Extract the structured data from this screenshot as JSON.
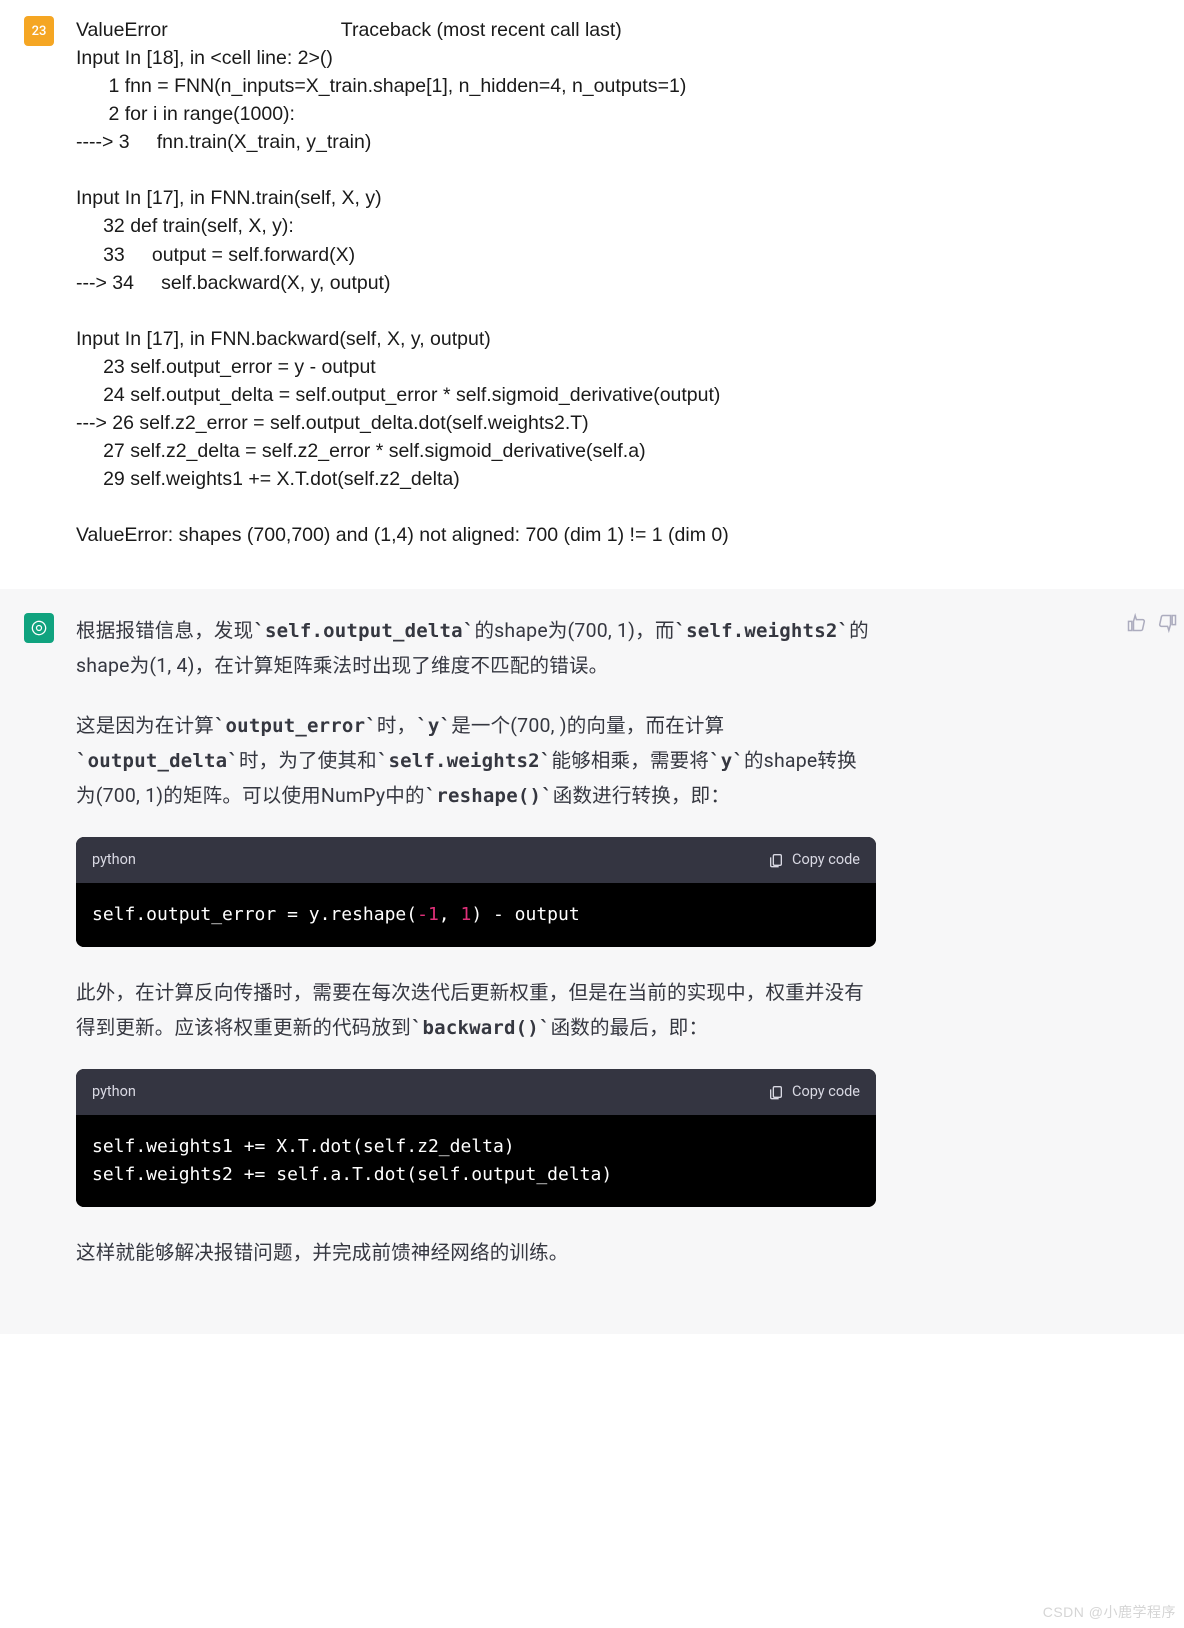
{
  "user": {
    "badge": "23",
    "traceback": {
      "l1": "ValueError                                Traceback (most recent call last)",
      "l2": "Input In [18], in <cell line: 2>()",
      "l3": "      1 fnn = FNN(n_inputs=X_train.shape[1], n_hidden=4, n_outputs=1)",
      "l4": "      2 for i in range(1000):",
      "l5": "----> 3     fnn.train(X_train, y_train)",
      "l6": "Input In [17], in FNN.train(self, X, y)",
      "l7": "     32 def train(self, X, y):",
      "l8": "     33     output = self.forward(X)",
      "l9": "---> 34     self.backward(X, y, output)",
      "l10": "Input In [17], in FNN.backward(self, X, y, output)",
      "l11": "     23 self.output_error = y - output",
      "l12": "     24 self.output_delta = self.output_error * self.sigmoid_derivative(output)",
      "l13": "---> 26 self.z2_error = self.output_delta.dot(self.weights2.T)",
      "l14": "     27 self.z2_delta = self.z2_error * self.sigmoid_derivative(self.a)",
      "l15": "     29 self.weights1 += X.T.dot(self.z2_delta)",
      "l16": "ValueError: shapes (700,700) and (1,4) not aligned: 700 (dim 1) != 1 (dim 0)"
    }
  },
  "assistant": {
    "p1": {
      "t1": "根据报错信息，发现",
      "c1": "`self.output_delta`",
      "t2": "的shape为(700, 1)，而",
      "c2": "`self.weights2`",
      "t3": "的shape为(1, 4)，在计算矩阵乘法时出现了维度不匹配的错误。"
    },
    "p2": {
      "t1": "这是因为在计算",
      "c1": "`output_error`",
      "t2": "时，",
      "c2": "`y`",
      "t3": "是一个(700, )的向量，而在计算",
      "c3": "`output_delta`",
      "t4": "时，为了使其和",
      "c4": "`self.weights2`",
      "t5": "能够相乘，需要将",
      "c5": "`y`",
      "t6": "的shape转换为(700, 1)的矩阵。可以使用NumPy中的",
      "c6": "`reshape()`",
      "t7": "函数进行转换，即："
    },
    "code1": {
      "lang": "python",
      "copy": "Copy code",
      "pre": "self.output_error = y.reshape(",
      "n1": "-1",
      "sep": ", ",
      "n2": "1",
      "post": ") - output"
    },
    "p3": {
      "t1": "此外，在计算反向传播时，需要在每次迭代后更新权重，但是在当前的实现中，权重并没有得到更新。应该将权重更新的代码放到",
      "c1": "`backward()`",
      "t2": "函数的最后，即："
    },
    "code2": {
      "lang": "python",
      "copy": "Copy code",
      "l1": "self.weights1 += X.T.dot(self.z2_delta)",
      "l2": "self.weights2 += self.a.T.dot(self.output_delta)"
    },
    "p4": "这样就能够解决报错问题，并完成前馈神经网络的训练。"
  },
  "watermark": "CSDN @小鹿学程序"
}
